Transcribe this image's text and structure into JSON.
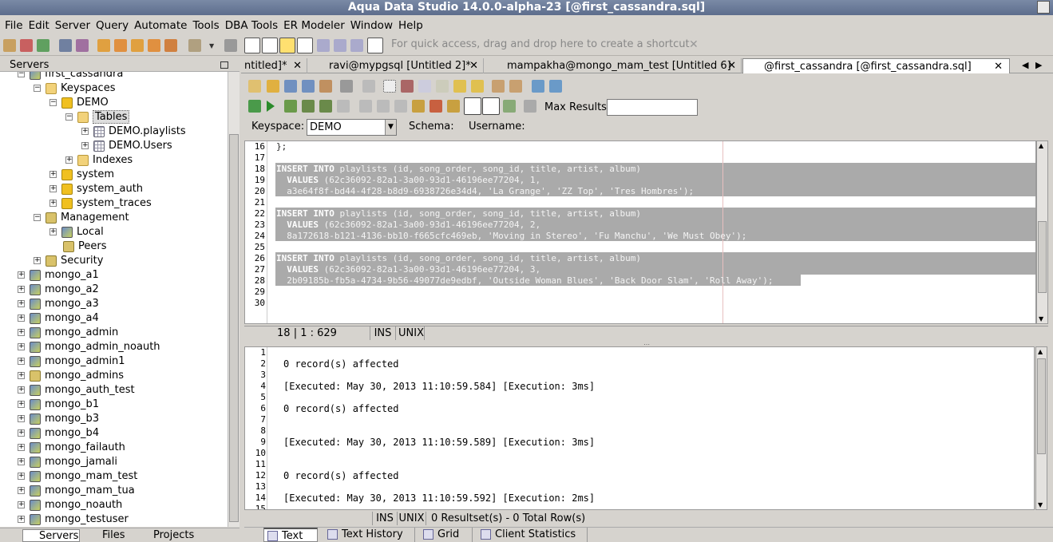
{
  "window": {
    "title": "Aqua Data Studio 14.0.0-alpha-23 [@first_cassandra.sql]"
  },
  "menu": [
    "File",
    "Edit",
    "Server",
    "Query",
    "Automate",
    "Tools",
    "DBA Tools",
    "ER Modeler",
    "Window",
    "Help"
  ],
  "quick_access": {
    "placeholder": "For quick access, drag and drop here to create a shortcut",
    "close": "✕"
  },
  "servers_panel": {
    "title": "Servers"
  },
  "tree": {
    "root": "first_cassandra",
    "keyspaces": "Keyspaces",
    "demo": "DEMO",
    "tables": "Tables",
    "table1": "DEMO.playlists",
    "table2": "DEMO.Users",
    "indexes": "Indexes",
    "system": "system",
    "system_auth": "system_auth",
    "system_traces": "system_traces",
    "management": "Management",
    "local": "Local",
    "peers": "Peers",
    "security": "Security",
    "servers": [
      "mongo_a1",
      "mongo_a2",
      "mongo_a3",
      "mongo_a4",
      "mongo_admin",
      "mongo_admin_noauth",
      "mongo_admin1",
      "mongo_admins",
      "mongo_auth_test",
      "mongo_b1",
      "mongo_b3",
      "mongo_b4",
      "mongo_failauth",
      "mongo_jamali",
      "mongo_mam_test",
      "mongo_mam_tua",
      "mongo_noauth",
      "mongo_testuser"
    ]
  },
  "left_tabs": {
    "servers": "Servers",
    "files": "Files",
    "projects": "Projects"
  },
  "editor_tabs": [
    {
      "label": "ntitled]*"
    },
    {
      "label": "ravi@mypgsql [Untitled 2]*"
    },
    {
      "label": "mampakha@mongo_mam_test [Untitled 6]"
    },
    {
      "label": "@first_cassandra [@first_cassandra.sql]"
    }
  ],
  "tab_close": "✕",
  "query_toolbar": {
    "max_results_label": "Max Results:",
    "max_results_value": ""
  },
  "context": {
    "keyspace_label": "Keyspace:",
    "keyspace_value": "DEMO",
    "schema_label": "Schema:",
    "username_label": "Username:"
  },
  "code_lines": [
    {
      "n": "16",
      "text": "};"
    },
    {
      "n": "17",
      "text": ""
    },
    {
      "n": "18",
      "kw": "INSERT INTO",
      "text": " playlists (id, song_order, song_id, title, artist, album)"
    },
    {
      "n": "19",
      "kw": "  VALUES",
      "text": " (62c36092-82a1-3a00-93d1-46196ee77204, 1,"
    },
    {
      "n": "20",
      "text": "  a3e64f8f-bd44-4f28-b8d9-6938726e34d4, 'La Grange', 'ZZ Top', 'Tres Hombres');"
    },
    {
      "n": "21",
      "text": ""
    },
    {
      "n": "22",
      "kw": "INSERT INTO",
      "text": " playlists (id, song_order, song_id, title, artist, album)"
    },
    {
      "n": "23",
      "kw": "  VALUES",
      "text": " (62c36092-82a1-3a00-93d1-46196ee77204, 2,"
    },
    {
      "n": "24",
      "text": "  8a172618-b121-4136-bb10-f665cfc469eb, 'Moving in Stereo', 'Fu Manchu', 'We Must Obey');"
    },
    {
      "n": "25",
      "text": ""
    },
    {
      "n": "26",
      "kw": "INSERT INTO",
      "text": " playlists (id, song_order, song_id, title, artist, album)"
    },
    {
      "n": "27",
      "kw": "  VALUES",
      "text": " (62c36092-82a1-3a00-93d1-46196ee77204, 3,"
    },
    {
      "n": "28",
      "text": "  2b09185b-fb5a-4734-9b56-49077de9edbf, 'Outside Woman Blues', 'Back Door Slam', 'Roll Away');"
    },
    {
      "n": "29",
      "text": ""
    },
    {
      "n": "30",
      "text": ""
    }
  ],
  "editor_status": {
    "position": "18 | 1 : 629",
    "mode": "INS",
    "eol": "UNIX"
  },
  "result_lines": [
    {
      "n": "1",
      "text": ""
    },
    {
      "n": "2",
      "text": "0 record(s) affected"
    },
    {
      "n": "3",
      "text": ""
    },
    {
      "n": "4",
      "text": "[Executed: May 30, 2013 11:10:59.584] [Execution: 3ms]"
    },
    {
      "n": "5",
      "text": ""
    },
    {
      "n": "6",
      "text": "0 record(s) affected"
    },
    {
      "n": "7",
      "text": ""
    },
    {
      "n": "8",
      "text": ""
    },
    {
      "n": "9",
      "text": "[Executed: May 30, 2013 11:10:59.589] [Execution: 3ms]"
    },
    {
      "n": "10",
      "text": ""
    },
    {
      "n": "11",
      "text": ""
    },
    {
      "n": "12",
      "text": "0 record(s) affected"
    },
    {
      "n": "13",
      "text": ""
    },
    {
      "n": "14",
      "text": "[Executed: May 30, 2013 11:10:59.592] [Execution: 2ms]"
    },
    {
      "n": "15",
      "text": ""
    }
  ],
  "results_status": {
    "mode": "INS",
    "eol": "UNIX",
    "summary": "0 Resultset(s) - 0 Total Row(s)"
  },
  "result_tabs": {
    "text": "Text",
    "history": "Text History",
    "grid": "Grid",
    "stats": "Client Statistics"
  }
}
